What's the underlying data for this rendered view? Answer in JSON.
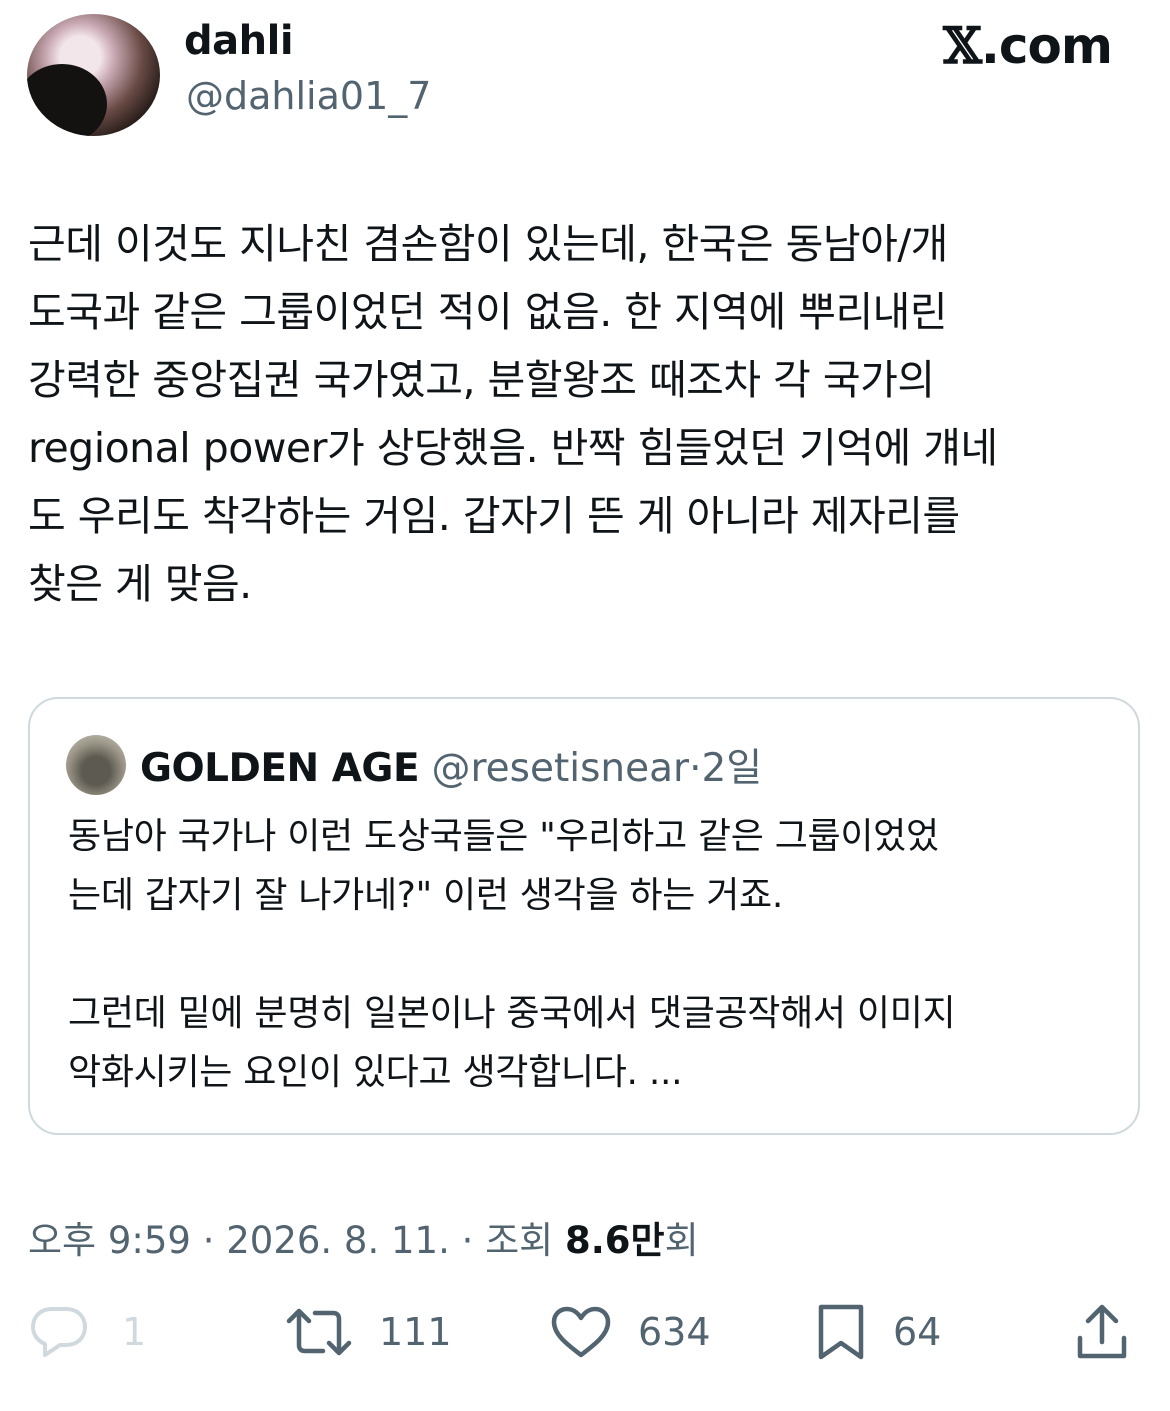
{
  "header": {
    "display_name": "dahli",
    "handle": "@dahlia01_7",
    "brand_x": "𝕏",
    "brand_suffix": ".com"
  },
  "tweet": {
    "text": "근데 이것도 지나친 겸손함이 있는데, 한국은 동남아/개\n도국과 같은 그룹이었던 적이 없음. 한 지역에 뿌리내린\n강력한 중앙집권 국가였고, 분할왕조 때조차 각 국가의\nregional power가 상당했음. 반짝 힘들었던 기억에 걔네\n도 우리도 착각하는 거임. 갑자기 뜬 게 아니라 제자리를\n찾은 게 맞음."
  },
  "quote": {
    "display_name": "GOLDEN AGE",
    "handle": "@resetisnear",
    "separator": "·",
    "age": "2일",
    "text": "동남아 국가나 이런 도상국들은 \"우리하고 같은 그룹이었었\n는데 갑자기 잘 나가네?\" 이런 생각을 하는 거죠.\n\n그런데 밑에 분명히 일본이나 중국에서 댓글공작해서 이미지\n악화시키는 요인이 있다고 생각합니다. ..."
  },
  "meta": {
    "time": "오후 9:59",
    "separator": "·",
    "date": "2026. 8. 11.",
    "views_label": "조회",
    "views_value": "8.6만",
    "views_suffix": "회"
  },
  "actions": {
    "reply_icon": "speech-bubble-icon",
    "reply_count": "1",
    "retweet_icon": "retweet-icon",
    "retweet_count": "111",
    "like_icon": "heart-icon",
    "like_count": "634",
    "bookmark_icon": "bookmark-icon",
    "bookmark_count": "64",
    "share_icon": "share-icon"
  },
  "colors": {
    "text_primary": "#0f1419",
    "text_secondary": "#536471",
    "border": "#cfd9de"
  }
}
